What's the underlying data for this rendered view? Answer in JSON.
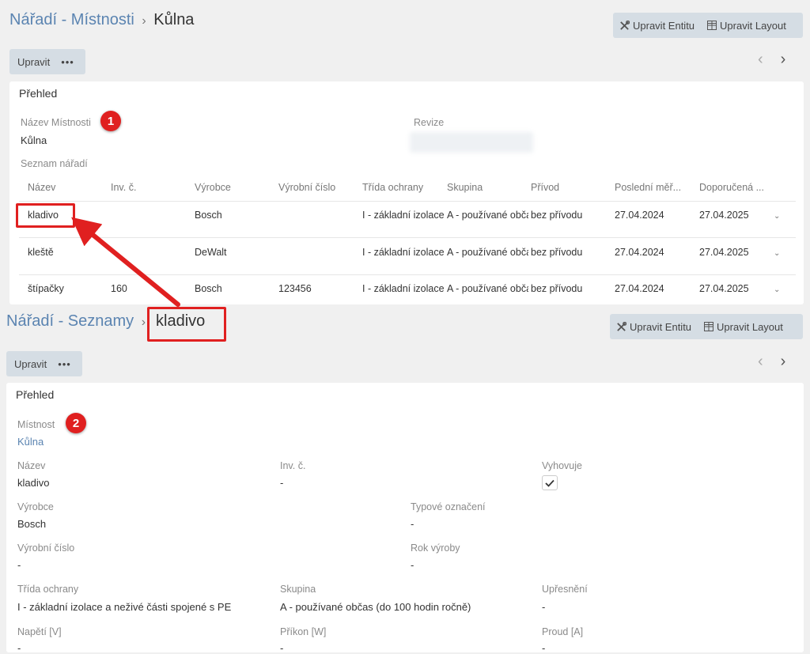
{
  "top": {
    "breadcrumb": {
      "parent": "Nářadí - Místnosti",
      "separator": "›",
      "current": "Kůlna"
    },
    "edit_entity_label": "Upravit Entitu",
    "edit_layout_label": "Upravit Layout",
    "edit_button_label": "Upravit",
    "more_label": "•••",
    "panel_title": "Přehled",
    "badge": "1",
    "fields": {
      "room_name_label": "Název Místnosti",
      "room_name_value": "Kůlna",
      "revision_label": "Revize"
    },
    "tool_list_label": "Seznam nářadí",
    "table": {
      "columns": [
        "Název",
        "Inv. č.",
        "Výrobce",
        "Výrobní číslo",
        "Třída ochrany",
        "Skupina",
        "Přívod",
        "Poslední měř...",
        "Doporučená ..."
      ],
      "rows": [
        {
          "name": "kladivo",
          "inv": "",
          "maker": "Bosch",
          "serial": "",
          "class": "I - základní izolace",
          "group": "A - používané občas",
          "supply": "bez přívodu",
          "last": "27.04.2024",
          "next": "27.04.2025"
        },
        {
          "name": "kleště",
          "inv": "",
          "maker": "DeWalt",
          "serial": "",
          "class": "I - základní izolace",
          "group": "A - používané občas",
          "supply": "bez přívodu",
          "last": "27.04.2024",
          "next": "27.04.2025"
        },
        {
          "name": "štípačky",
          "inv": "160",
          "maker": "Bosch",
          "serial": "123456",
          "class": "I - základní izolace",
          "group": "A - používané občas",
          "supply": "bez přívodu",
          "last": "27.04.2024",
          "next": "27.04.2025"
        }
      ]
    }
  },
  "bottom": {
    "breadcrumb": {
      "parent": "Nářadí - Seznamy",
      "separator": "›",
      "current": "kladivo"
    },
    "edit_entity_label": "Upravit Entitu",
    "edit_layout_label": "Upravit Layout",
    "edit_button_label": "Upravit",
    "more_label": "•••",
    "panel_title": "Přehled",
    "badge": "2",
    "fields": {
      "room_label": "Místnost",
      "room_value": "Kůlna",
      "name_label": "Název",
      "name_value": "kladivo",
      "inv_label": "Inv. č.",
      "inv_value": "-",
      "complies_label": "Vyhovuje",
      "complies_checked": true,
      "maker_label": "Výrobce",
      "maker_value": "Bosch",
      "type_label": "Typové označení",
      "type_value": "-",
      "serial_label": "Výrobní číslo",
      "serial_value": "-",
      "year_label": "Rok výroby",
      "year_value": "-",
      "class_label": "Třída ochrany",
      "class_value": "I - základní izolace a neživé části spojené s PE",
      "group_label": "Skupina",
      "group_value": "A - používané občas (do 100 hodin ročně)",
      "spec_label": "Upřesnění",
      "spec_value": "-",
      "voltage_label": "Napětí [V]",
      "voltage_value": "-",
      "power_label": "Příkon [W]",
      "power_value": "-",
      "current_label": "Proud [A]",
      "current_value": "-"
    }
  },
  "colors": {
    "link": "#5b84b1",
    "annotation_red": "#e02020",
    "button_bg": "#d5dde4"
  },
  "icons": {
    "edit_entity": "tools-icon",
    "edit_layout": "layout-grid-icon",
    "prev": "chevron-left-icon",
    "next": "chevron-right-icon"
  }
}
